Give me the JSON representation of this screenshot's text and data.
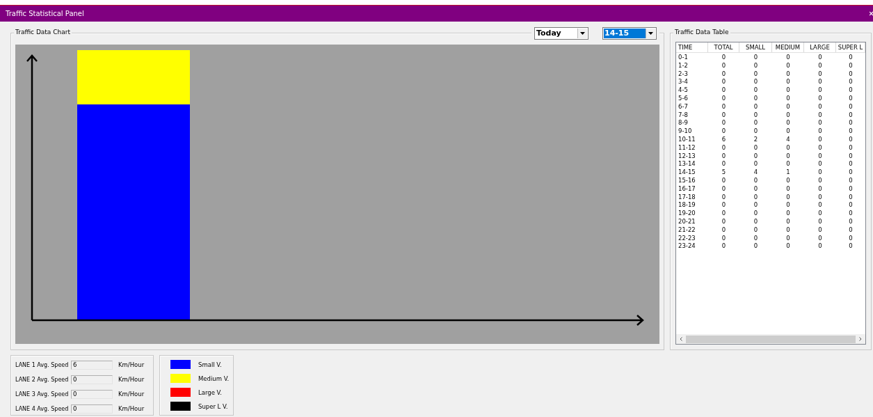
{
  "window": {
    "title": "Traffic Statistical Panel"
  },
  "chart_panel": {
    "title": "Traffic Data Chart",
    "day_select": {
      "value": "Today",
      "focused": false
    },
    "hour_select": {
      "value": "14-15",
      "focused": true
    }
  },
  "table_panel": {
    "title": "Traffic Data Table",
    "columns": [
      "TIME",
      "TOTAL",
      "SMALL",
      "MEDIUM",
      "LARGE",
      "SUPER L"
    ],
    "rows": [
      [
        "0-1",
        "0",
        "0",
        "0",
        "0",
        "0"
      ],
      [
        "1-2",
        "0",
        "0",
        "0",
        "0",
        "0"
      ],
      [
        "2-3",
        "0",
        "0",
        "0",
        "0",
        "0"
      ],
      [
        "3-4",
        "0",
        "0",
        "0",
        "0",
        "0"
      ],
      [
        "4-5",
        "0",
        "0",
        "0",
        "0",
        "0"
      ],
      [
        "5-6",
        "0",
        "0",
        "0",
        "0",
        "0"
      ],
      [
        "6-7",
        "0",
        "0",
        "0",
        "0",
        "0"
      ],
      [
        "7-8",
        "0",
        "0",
        "0",
        "0",
        "0"
      ],
      [
        "8-9",
        "0",
        "0",
        "0",
        "0",
        "0"
      ],
      [
        "9-10",
        "0",
        "0",
        "0",
        "0",
        "0"
      ],
      [
        "10-11",
        "6",
        "2",
        "4",
        "0",
        "0"
      ],
      [
        "11-12",
        "0",
        "0",
        "0",
        "0",
        "0"
      ],
      [
        "12-13",
        "0",
        "0",
        "0",
        "0",
        "0"
      ],
      [
        "13-14",
        "0",
        "0",
        "0",
        "0",
        "0"
      ],
      [
        "14-15",
        "5",
        "4",
        "1",
        "0",
        "0"
      ],
      [
        "15-16",
        "0",
        "0",
        "0",
        "0",
        "0"
      ],
      [
        "16-17",
        "0",
        "0",
        "0",
        "0",
        "0"
      ],
      [
        "17-18",
        "0",
        "0",
        "0",
        "0",
        "0"
      ],
      [
        "18-19",
        "0",
        "0",
        "0",
        "0",
        "0"
      ],
      [
        "19-20",
        "0",
        "0",
        "0",
        "0",
        "0"
      ],
      [
        "20-21",
        "0",
        "0",
        "0",
        "0",
        "0"
      ],
      [
        "21-22",
        "0",
        "0",
        "0",
        "0",
        "0"
      ],
      [
        "22-23",
        "0",
        "0",
        "0",
        "0",
        "0"
      ],
      [
        "23-24",
        "0",
        "0",
        "0",
        "0",
        "0"
      ]
    ]
  },
  "lanes": [
    {
      "label": "LANE 1 Avg. Speed",
      "value": "6",
      "unit": "Km/Hour"
    },
    {
      "label": "LANE 2 Avg. Speed",
      "value": "0",
      "unit": "Km/Hour"
    },
    {
      "label": "LANE 3 Avg. Speed",
      "value": "0",
      "unit": "Km/Hour"
    },
    {
      "label": "LANE 4 Avg. Speed",
      "value": "0",
      "unit": "Km/Hour"
    }
  ],
  "legend": [
    {
      "label": "Small V.",
      "color": "#0000ff"
    },
    {
      "label": "Medium V.",
      "color": "#ffff00"
    },
    {
      "label": "Large V.",
      "color": "#ff0000"
    },
    {
      "label": "Super L V.",
      "color": "#000000"
    }
  ]
}
